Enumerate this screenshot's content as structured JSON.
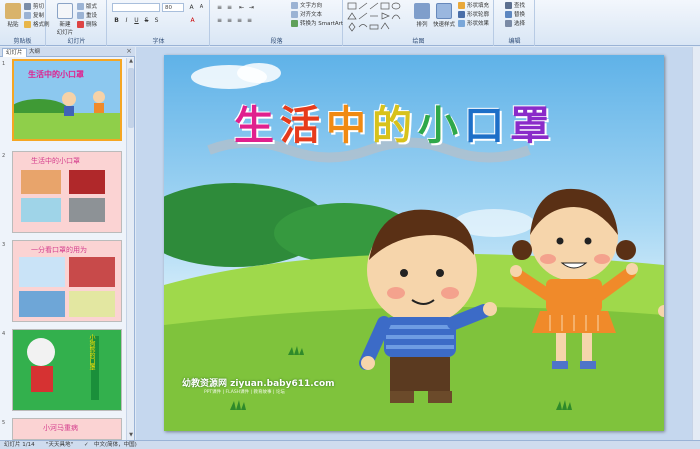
{
  "ribbon": {
    "clipboard": {
      "paste": "粘贴",
      "cut": "剪切",
      "copy": "复制",
      "format_painter": "格式刷",
      "label": "剪贴板"
    },
    "slides": {
      "new_slide": "新建\n幻灯片",
      "layout": "版式",
      "reset": "重设",
      "delete": "删除",
      "label": "幻灯片"
    },
    "font": {
      "font_name": "",
      "font_size": "80",
      "label": "字体"
    },
    "paragraph": {
      "text_direction": "文字方向",
      "align_text": "对齐文本",
      "convert_smartart": "转换为 SmartArt",
      "label": "段落"
    },
    "drawing": {
      "arrange": "排列",
      "quick_styles": "快速样式",
      "shape_fill": "形状填充",
      "shape_outline": "形状轮廓",
      "shape_effects": "形状效果",
      "label": "绘图"
    },
    "editing": {
      "find": "查找",
      "replace": "替换",
      "select": "选择",
      "label": "编辑"
    }
  },
  "panel": {
    "tab_slides": "幻灯片",
    "tab_outline": "大纲",
    "close": "×",
    "thumbnails": [
      {
        "num": "1",
        "title": "生活中的小口罩"
      },
      {
        "num": "2",
        "title": "生活中的小口罩"
      },
      {
        "num": "3",
        "title": "一分看口罩的用为"
      },
      {
        "num": "4",
        "title": "小狗熊的口罩"
      },
      {
        "num": "5",
        "title": "小河马重病"
      }
    ]
  },
  "slide": {
    "title_chars": [
      "生",
      "活",
      "中",
      "的",
      "小",
      "口",
      "罩"
    ],
    "watermark": "幼教资源网 ziyuan.baby611.com",
    "watermark_sub": "PPT课件 | FLASH课件 | 教育故事 | 论坛"
  },
  "status": {
    "slide_counter": "幻灯片 1/14",
    "theme": "\"天天具地\"",
    "language": "中文(简体，中国)"
  }
}
